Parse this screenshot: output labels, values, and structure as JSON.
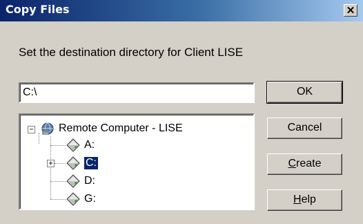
{
  "window": {
    "title": "Copy Files"
  },
  "prompt": "Set the destination directory for Client LISE",
  "path_input": {
    "value": "C:\\"
  },
  "tree": {
    "root": {
      "label": "Remote Computer - LISE",
      "expanded": true,
      "icon": "computer-icon"
    },
    "drives": [
      {
        "label": "A:",
        "icon": "drive-icon",
        "expandable": false,
        "selected": false
      },
      {
        "label": "C:",
        "icon": "drive-icon",
        "expandable": true,
        "selected": true
      },
      {
        "label": "D:",
        "icon": "drive-icon",
        "expandable": false,
        "selected": false
      },
      {
        "label": "G:",
        "icon": "drive-icon",
        "expandable": false,
        "selected": false
      }
    ]
  },
  "buttons": {
    "ok": "OK",
    "cancel": "Cancel",
    "create_mnemonic": "C",
    "create_rest": "reate",
    "help_mnemonic": "H",
    "help_rest": "elp"
  },
  "colors": {
    "title_start": "#0a246a",
    "title_end": "#a6caf0",
    "face": "#d4d0c8",
    "selection": "#0a246a"
  }
}
